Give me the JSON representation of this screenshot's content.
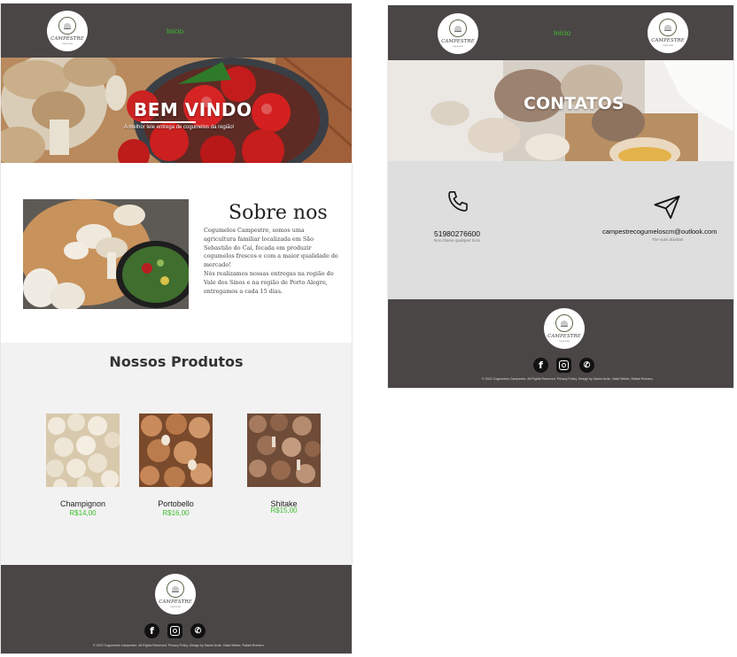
{
  "home": {
    "logo": {
      "brand": "CAMPESTRE",
      "tagline": "cogumelos"
    },
    "nav": {
      "inicio": "Início"
    },
    "hero": {
      "title": "BEM VINDO",
      "subtitle": "A melhor tele entrega de cogumelos da região!"
    },
    "about": {
      "title": "Sobre nos",
      "paragraph1": "Cogumelos Campestre, somos uma agricultura familiar localizada em São Sebastião do Caí, focada em produzir cogumelos frescos e com a maior qualidade do mercado!",
      "paragraph2": "Nós realizamos nossas entregas na região do Vale dos Sinos e na região de Porto Alegre, entregamos a cada 15 dias."
    },
    "products": {
      "title": "Nossos Produtos",
      "items": [
        {
          "name": "Champignon",
          "price": "R$14,00"
        },
        {
          "name": "Portobello",
          "price": "R$16,00"
        },
        {
          "name": "Shitake",
          "price": "R$15,00"
        }
      ]
    },
    "footer": {
      "copyright": "© 2022 Cogumelos Campestre. All Rights Reserved. Privacy Policy. Design by Daniel Avila, Yasid Weber, Rafael Romero."
    }
  },
  "contact": {
    "logo_left": {
      "brand": "CAMPESTRE",
      "tagline": "cogumelos"
    },
    "logo_right": {
      "brand": "CAMPESTRE",
      "tagline": "cogumelos"
    },
    "nav": {
      "inicio": "Início"
    },
    "hero": {
      "title": "CONTATOS"
    },
    "phone": {
      "number": "51980276600",
      "caption": "Nos chame qualquer hora"
    },
    "email": {
      "address": "campestrecogumeloscm@outlook.com",
      "caption": "Tire suas dúvidas"
    },
    "footer": {
      "copyright": "© 2022 Cogumelos Campestre. All Rights Reserved. Privacy Policy. Design by Daniel Avila, Yasid Weber, Rafael Romero."
    }
  },
  "colors": {
    "header_bg": "#4a4646",
    "accent_green": "#3fbf2f",
    "contact_panel": "#dedede",
    "products_bg": "#f2f2f2"
  },
  "social_icons": [
    "facebook-icon",
    "instagram-icon",
    "whatsapp-icon"
  ]
}
